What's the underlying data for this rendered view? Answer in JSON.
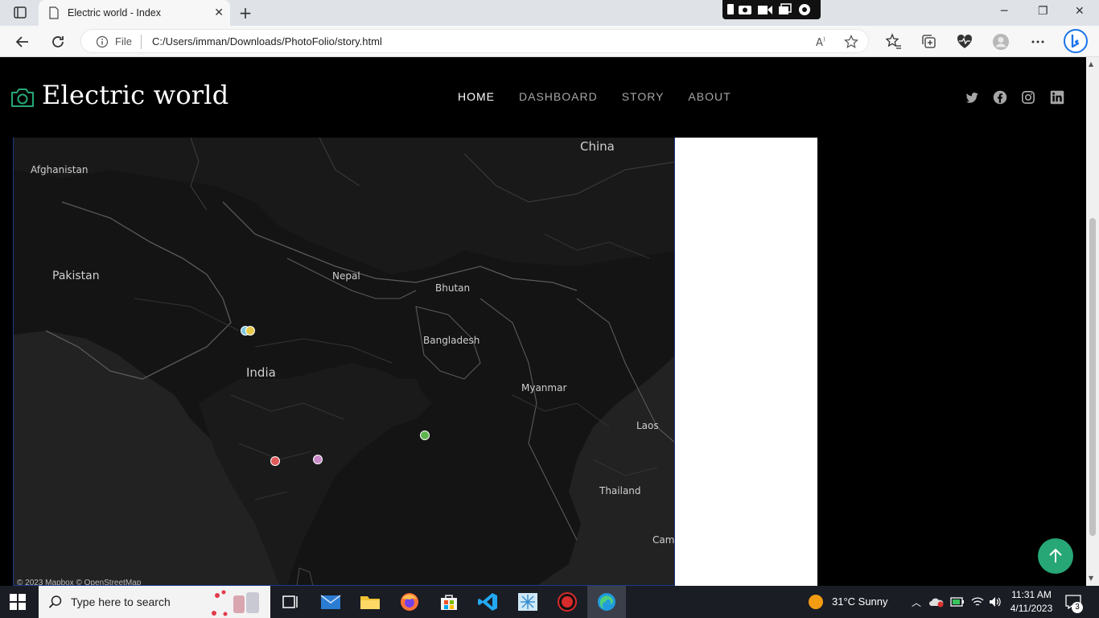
{
  "browser": {
    "tab_title": "Electric world - Index",
    "file_label": "File",
    "url": "C:/Users/imman/Downloads/PhotoFolio/story.html"
  },
  "site": {
    "brand": "Electric world",
    "nav": [
      {
        "label": "HOME",
        "active": true
      },
      {
        "label": "DASHBOARD",
        "active": false
      },
      {
        "label": "STORY",
        "active": false
      },
      {
        "label": "ABOUT",
        "active": false
      }
    ],
    "social_icons": [
      "twitter-icon",
      "facebook-icon",
      "instagram-icon",
      "linkedin-icon"
    ],
    "accent_color": "#27a776"
  },
  "map": {
    "labels": {
      "china": "China",
      "afghanistan": "Afghanistan",
      "pakistan": "Pakistan",
      "nepal": "Nepal",
      "bhutan": "Bhutan",
      "bangladesh": "Bangladesh",
      "india": "India",
      "myanmar": "Myanmar",
      "laos": "Laos",
      "thailand": "Thailand",
      "cam": "Cam"
    },
    "attribution": "© 2023 Mapbox © OpenStreetMap",
    "markers": [
      {
        "name": "marker-delhi",
        "color": "#7fc6e0"
      },
      {
        "name": "marker-delhi-2",
        "color": "#e6c84a"
      },
      {
        "name": "marker-kolkata",
        "color": "#5fb44f"
      },
      {
        "name": "marker-central-red",
        "color": "#e05a5a"
      },
      {
        "name": "marker-central-purple",
        "color": "#c98ac9"
      },
      {
        "name": "marker-chennai",
        "color": "#f29a2e"
      }
    ]
  },
  "taskbar": {
    "search_placeholder": "Type here to search",
    "weather": "31°C  Sunny",
    "time": "11:31 AM",
    "date": "4/11/2023",
    "notifications": "3"
  }
}
